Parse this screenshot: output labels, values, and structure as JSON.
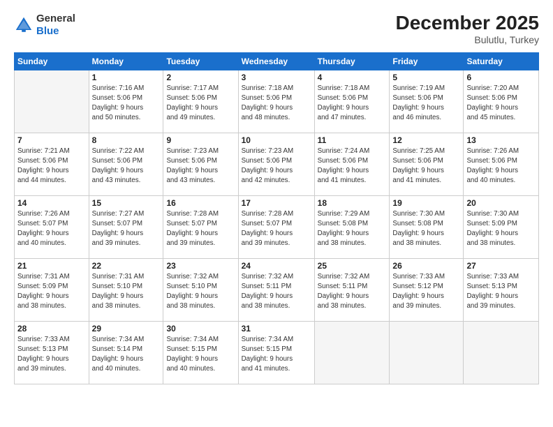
{
  "logo": {
    "general": "General",
    "blue": "Blue"
  },
  "header": {
    "month": "December 2025",
    "location": "Bulutlu, Turkey"
  },
  "weekdays": [
    "Sunday",
    "Monday",
    "Tuesday",
    "Wednesday",
    "Thursday",
    "Friday",
    "Saturday"
  ],
  "weeks": [
    [
      {
        "day": "",
        "info": ""
      },
      {
        "day": "1",
        "info": "Sunrise: 7:16 AM\nSunset: 5:06 PM\nDaylight: 9 hours\nand 50 minutes."
      },
      {
        "day": "2",
        "info": "Sunrise: 7:17 AM\nSunset: 5:06 PM\nDaylight: 9 hours\nand 49 minutes."
      },
      {
        "day": "3",
        "info": "Sunrise: 7:18 AM\nSunset: 5:06 PM\nDaylight: 9 hours\nand 48 minutes."
      },
      {
        "day": "4",
        "info": "Sunrise: 7:18 AM\nSunset: 5:06 PM\nDaylight: 9 hours\nand 47 minutes."
      },
      {
        "day": "5",
        "info": "Sunrise: 7:19 AM\nSunset: 5:06 PM\nDaylight: 9 hours\nand 46 minutes."
      },
      {
        "day": "6",
        "info": "Sunrise: 7:20 AM\nSunset: 5:06 PM\nDaylight: 9 hours\nand 45 minutes."
      }
    ],
    [
      {
        "day": "7",
        "info": "Sunrise: 7:21 AM\nSunset: 5:06 PM\nDaylight: 9 hours\nand 44 minutes."
      },
      {
        "day": "8",
        "info": "Sunrise: 7:22 AM\nSunset: 5:06 PM\nDaylight: 9 hours\nand 43 minutes."
      },
      {
        "day": "9",
        "info": "Sunrise: 7:23 AM\nSunset: 5:06 PM\nDaylight: 9 hours\nand 43 minutes."
      },
      {
        "day": "10",
        "info": "Sunrise: 7:23 AM\nSunset: 5:06 PM\nDaylight: 9 hours\nand 42 minutes."
      },
      {
        "day": "11",
        "info": "Sunrise: 7:24 AM\nSunset: 5:06 PM\nDaylight: 9 hours\nand 41 minutes."
      },
      {
        "day": "12",
        "info": "Sunrise: 7:25 AM\nSunset: 5:06 PM\nDaylight: 9 hours\nand 41 minutes."
      },
      {
        "day": "13",
        "info": "Sunrise: 7:26 AM\nSunset: 5:06 PM\nDaylight: 9 hours\nand 40 minutes."
      }
    ],
    [
      {
        "day": "14",
        "info": "Sunrise: 7:26 AM\nSunset: 5:07 PM\nDaylight: 9 hours\nand 40 minutes."
      },
      {
        "day": "15",
        "info": "Sunrise: 7:27 AM\nSunset: 5:07 PM\nDaylight: 9 hours\nand 39 minutes."
      },
      {
        "day": "16",
        "info": "Sunrise: 7:28 AM\nSunset: 5:07 PM\nDaylight: 9 hours\nand 39 minutes."
      },
      {
        "day": "17",
        "info": "Sunrise: 7:28 AM\nSunset: 5:07 PM\nDaylight: 9 hours\nand 39 minutes."
      },
      {
        "day": "18",
        "info": "Sunrise: 7:29 AM\nSunset: 5:08 PM\nDaylight: 9 hours\nand 38 minutes."
      },
      {
        "day": "19",
        "info": "Sunrise: 7:30 AM\nSunset: 5:08 PM\nDaylight: 9 hours\nand 38 minutes."
      },
      {
        "day": "20",
        "info": "Sunrise: 7:30 AM\nSunset: 5:09 PM\nDaylight: 9 hours\nand 38 minutes."
      }
    ],
    [
      {
        "day": "21",
        "info": "Sunrise: 7:31 AM\nSunset: 5:09 PM\nDaylight: 9 hours\nand 38 minutes."
      },
      {
        "day": "22",
        "info": "Sunrise: 7:31 AM\nSunset: 5:10 PM\nDaylight: 9 hours\nand 38 minutes."
      },
      {
        "day": "23",
        "info": "Sunrise: 7:32 AM\nSunset: 5:10 PM\nDaylight: 9 hours\nand 38 minutes."
      },
      {
        "day": "24",
        "info": "Sunrise: 7:32 AM\nSunset: 5:11 PM\nDaylight: 9 hours\nand 38 minutes."
      },
      {
        "day": "25",
        "info": "Sunrise: 7:32 AM\nSunset: 5:11 PM\nDaylight: 9 hours\nand 38 minutes."
      },
      {
        "day": "26",
        "info": "Sunrise: 7:33 AM\nSunset: 5:12 PM\nDaylight: 9 hours\nand 39 minutes."
      },
      {
        "day": "27",
        "info": "Sunrise: 7:33 AM\nSunset: 5:13 PM\nDaylight: 9 hours\nand 39 minutes."
      }
    ],
    [
      {
        "day": "28",
        "info": "Sunrise: 7:33 AM\nSunset: 5:13 PM\nDaylight: 9 hours\nand 39 minutes."
      },
      {
        "day": "29",
        "info": "Sunrise: 7:34 AM\nSunset: 5:14 PM\nDaylight: 9 hours\nand 40 minutes."
      },
      {
        "day": "30",
        "info": "Sunrise: 7:34 AM\nSunset: 5:15 PM\nDaylight: 9 hours\nand 40 minutes."
      },
      {
        "day": "31",
        "info": "Sunrise: 7:34 AM\nSunset: 5:15 PM\nDaylight: 9 hours\nand 41 minutes."
      },
      {
        "day": "",
        "info": ""
      },
      {
        "day": "",
        "info": ""
      },
      {
        "day": "",
        "info": ""
      }
    ]
  ]
}
